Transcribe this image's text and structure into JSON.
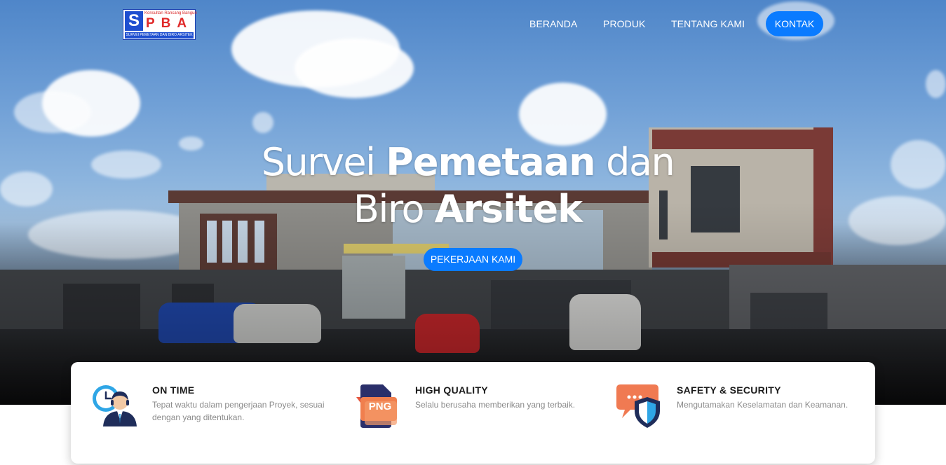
{
  "logo": {
    "letter_s": "S",
    "letters": "PBA",
    "tagline_top": "Konsultan Rancang Bangun",
    "tagline_bottom": "SURVEI PEMETAAN DAN BIRO ARSITEK"
  },
  "nav": {
    "items": [
      "BERANDA",
      "PRODUK",
      "TENTANG KAMI"
    ],
    "cta": "KONTAK"
  },
  "hero": {
    "line1_regular": "Survei ",
    "line1_bold": "Pemetaan",
    "line1_end": " dan",
    "line2_regular": "Biro ",
    "line2_bold": "Arsitek",
    "button": "PEKERJAAN KAMI"
  },
  "features": [
    {
      "title": "ON TIME",
      "desc": "Tepat waktu dalam pengerjaan Proyek, sesuai dengan yang ditentukan.",
      "icon": "clock-person-icon"
    },
    {
      "title": "HIGH QUALITY",
      "desc": "Selalu berusaha memberikan yang terbaik.",
      "icon": "png-file-icon",
      "icon_label": "PNG"
    },
    {
      "title": "SAFETY & SECURITY",
      "desc": "Mengutamakan Keselamatan dan Keamanan.",
      "icon": "shield-chat-icon"
    }
  ],
  "colors": {
    "accent": "#0a7bff",
    "logo_blue": "#1f4fd0",
    "logo_red": "#e02a2a"
  }
}
